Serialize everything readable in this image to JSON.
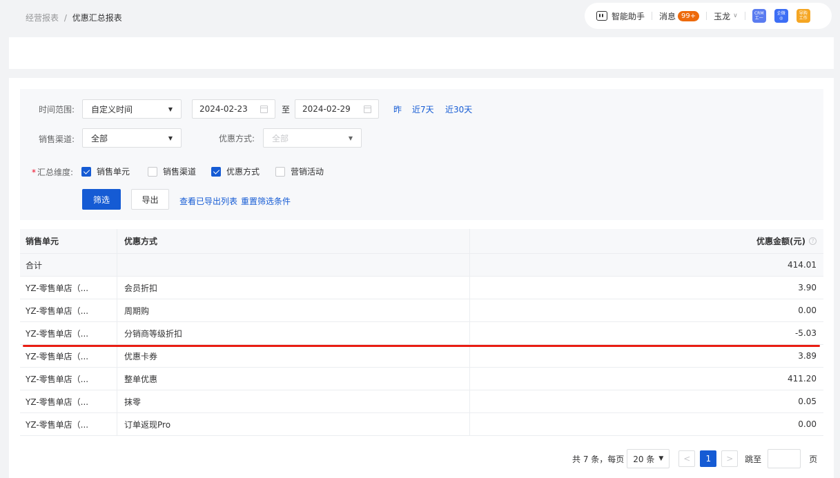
{
  "breadcrumb": {
    "parent": "经营报表",
    "separator": "/",
    "current": "优惠汇总报表"
  },
  "topbar": {
    "assistant": "智能助手",
    "messages_label": "消息",
    "messages_badge": "99+",
    "user": "玉龙",
    "apps": [
      {
        "line1": "CRM",
        "line2": "工一",
        "color": "#5b7cf0"
      },
      {
        "line1": "企微",
        "line2": "◎",
        "color": "#3d6ef5"
      },
      {
        "line1": "导购",
        "line2": "工作",
        "color": "#f5a623"
      }
    ]
  },
  "filters": {
    "time_range_label": "时间范围:",
    "time_range_value": "自定义时间",
    "start_date": "2024-02-23",
    "to_label": "至",
    "end_date": "2024-02-29",
    "quick_links": [
      "昨",
      "近7天",
      "近30天"
    ],
    "channel_label": "销售渠道:",
    "channel_value": "全部",
    "discount_type_label": "优惠方式:",
    "discount_type_placeholder": "全部",
    "dimension_label": "汇总维度:",
    "dimensions": [
      {
        "label": "销售单元",
        "checked": true
      },
      {
        "label": "销售渠道",
        "checked": false
      },
      {
        "label": "优惠方式",
        "checked": true
      },
      {
        "label": "营销活动",
        "checked": false
      }
    ],
    "filter_button": "筛选",
    "export_button": "导出",
    "view_exports_link": "查看已导出列表",
    "reset_link": "重置筛选条件"
  },
  "table": {
    "headers": [
      "销售单元",
      "优惠方式",
      "优惠金额(元)"
    ],
    "total": {
      "label": "合计",
      "amount": "414.01"
    },
    "rows": [
      {
        "unit": "YZ-零售单店（...",
        "method": "会员折扣",
        "amount": "3.90"
      },
      {
        "unit": "YZ-零售单店（...",
        "method": "周期购",
        "amount": "0.00"
      },
      {
        "unit": "YZ-零售单店（...",
        "method": "分销商等级折扣",
        "amount": "-5.03"
      },
      {
        "unit": "YZ-零售单店（...",
        "method": "优惠卡券",
        "amount": "3.89"
      },
      {
        "unit": "YZ-零售单店（...",
        "method": "整单优惠",
        "amount": "411.20"
      },
      {
        "unit": "YZ-零售单店（...",
        "method": "抹零",
        "amount": "0.05"
      },
      {
        "unit": "YZ-零售单店（...",
        "method": "订单返现Pro",
        "amount": "0.00"
      }
    ]
  },
  "pagination": {
    "total_text": "共 7 条，每页",
    "page_size": "20 条",
    "current_page": "1",
    "jump_label": "跳至",
    "page_unit": "页"
  },
  "colors": {
    "accent": "#155bd4",
    "badge": "#ed6a0c",
    "annotation": "#e91c12"
  }
}
